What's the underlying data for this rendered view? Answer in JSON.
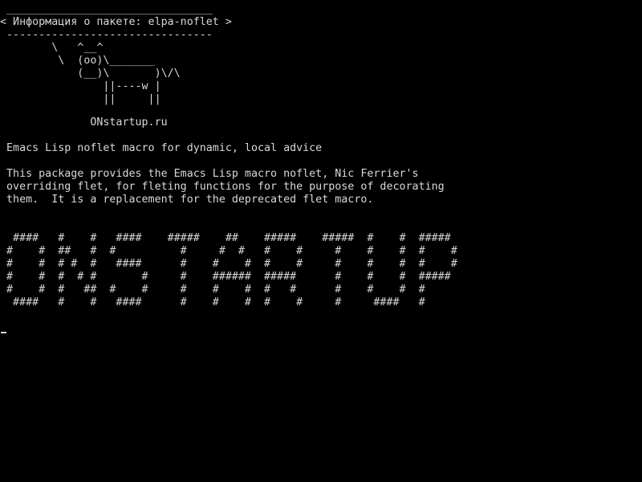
{
  "terminal": {
    "cowsay": [
      " ________________________________",
      "< Информация о пакете: elpa-noflet >",
      " --------------------------------",
      "        \\   ^__^",
      "         \\  (oo)\\_______",
      "            (__)\\       )\\/\\",
      "                ||----w |",
      "                ||     ||"
    ],
    "site_line": "              ONstartup.ru",
    "summary_line": " Emacs Lisp noflet macro for dynamic, local advice",
    "description_lines": [
      " This package provides the Emacs Lisp macro noflet, Nic Ferrier's",
      " overriding flet, for fleting functions for the purpose of decorating",
      " them.  It is a replacement for the deprecated flet macro."
    ],
    "banner_lines": [
      "  ####   #    #   ####    #####    ##    #####    #####  #    #  #####",
      " #    #  ##   #  #          #     #  #   #    #     #    #    #  #    #",
      " #    #  # #  #   ####      #    #    #  #    #     #    #    #  #    #",
      " #    #  #  # #       #     #    ######  #####      #    #    #  #####",
      " #    #  #   ##  #    #     #    #    #  #   #      #    #    #  #",
      "  ####   #    #   ####      #    #    #  #    #     #     ####   #"
    ]
  }
}
